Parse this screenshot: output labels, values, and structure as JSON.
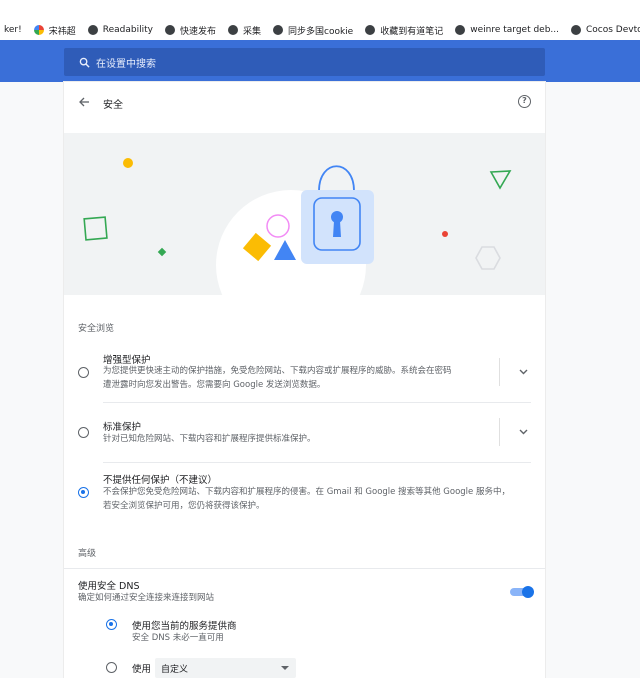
{
  "bookmarks": [
    {
      "label": "ker!",
      "icon": "none"
    },
    {
      "label": "宋祎超",
      "icon": "colorful-logo-icon"
    },
    {
      "label": "Readability",
      "icon": "globe-icon"
    },
    {
      "label": "快速发布",
      "icon": "globe-icon"
    },
    {
      "label": "采集",
      "icon": "globe-icon"
    },
    {
      "label": "同步多国cookie",
      "icon": "globe-icon"
    },
    {
      "label": "收藏到有道笔记",
      "icon": "globe-icon"
    },
    {
      "label": "weinre target deb...",
      "icon": "globe-icon"
    },
    {
      "label": "Cocos Devtools v...",
      "icon": "globe-icon"
    }
  ],
  "search": {
    "placeholder": "在设置中搜索"
  },
  "page": {
    "title": "安全"
  },
  "safe_browsing": {
    "section_title": "安全浏览",
    "options": [
      {
        "title": "增强型保护",
        "desc1": "为您提供更快速主动的保护措施，免受危险网站、下载内容或扩展程序的威胁。系统会在密码",
        "desc2": "遭泄露时向您发出警告。您需要向 Google 发送浏览数据。",
        "selected": false,
        "expandable": true
      },
      {
        "title": "标准保护",
        "desc1": "针对已知危险网站、下载内容和扩展程序提供标准保护。",
        "desc2": "",
        "selected": false,
        "expandable": true
      },
      {
        "title": "不提供任何保护（不建议）",
        "desc1": "不会保护您免受危险网站、下载内容和扩展程序的侵害。在 Gmail 和 Google 搜索等其他 Google 服务中，",
        "desc2": "若安全浏览保护可用，您仍将获得该保护。",
        "selected": true,
        "expandable": false
      }
    ]
  },
  "advanced": {
    "section_title": "高级",
    "secure_dns": {
      "title": "使用安全 DNS",
      "desc": "确定如何通过安全连接来连接到网站",
      "enabled": true
    },
    "provider_current": {
      "title": "使用您当前的服务提供商",
      "desc": "安全 DNS 未必一直可用",
      "selected": true
    },
    "provider_custom": {
      "label": "使用",
      "select_value": "自定义",
      "selected": false
    }
  },
  "colors": {
    "accent": "#1a73e8",
    "header": "#3a6fd8",
    "search_bg": "#2f5cb8"
  }
}
